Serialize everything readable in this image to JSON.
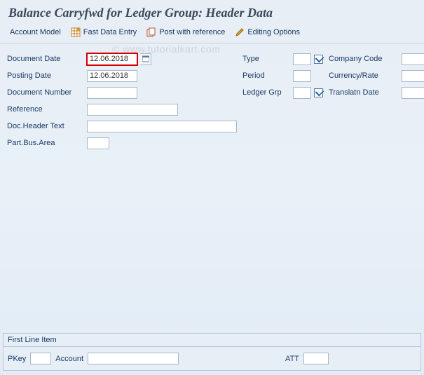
{
  "header": {
    "title": "Balance Carryfwd for Ledger Group: Header Data"
  },
  "toolbar": {
    "account_model": "Account Model",
    "fast_data_entry": "Fast Data Entry",
    "post_with_reference": "Post with reference",
    "editing_options": "Editing Options"
  },
  "fields": {
    "document_date": {
      "label": "Document Date",
      "value": "12.06.2018"
    },
    "posting_date": {
      "label": "Posting Date",
      "value": "12.06.2018"
    },
    "document_number": {
      "label": "Document Number",
      "value": ""
    },
    "reference": {
      "label": "Reference",
      "value": ""
    },
    "doc_header_text": {
      "label": "Doc.Header Text",
      "value": ""
    },
    "part_bus_area": {
      "label": "Part.Bus.Area",
      "value": ""
    },
    "type": {
      "label": "Type",
      "value": ""
    },
    "period": {
      "label": "Period",
      "value": ""
    },
    "ledger_grp": {
      "label": "Ledger Grp",
      "value": ""
    },
    "company_code": {
      "label": "Company Code",
      "value": ""
    },
    "currency_rate": {
      "label": "Currency/Rate",
      "value": "",
      "rate_value": ""
    },
    "translatn_date": {
      "label": "Translatn Date",
      "value": ""
    }
  },
  "first_line": {
    "title": "First Line Item",
    "pkey": {
      "label": "PKey",
      "value": ""
    },
    "account": {
      "label": "Account",
      "value": ""
    },
    "att": {
      "label": "ATT",
      "value": ""
    }
  },
  "watermark": "© www.tutorialkart.com"
}
